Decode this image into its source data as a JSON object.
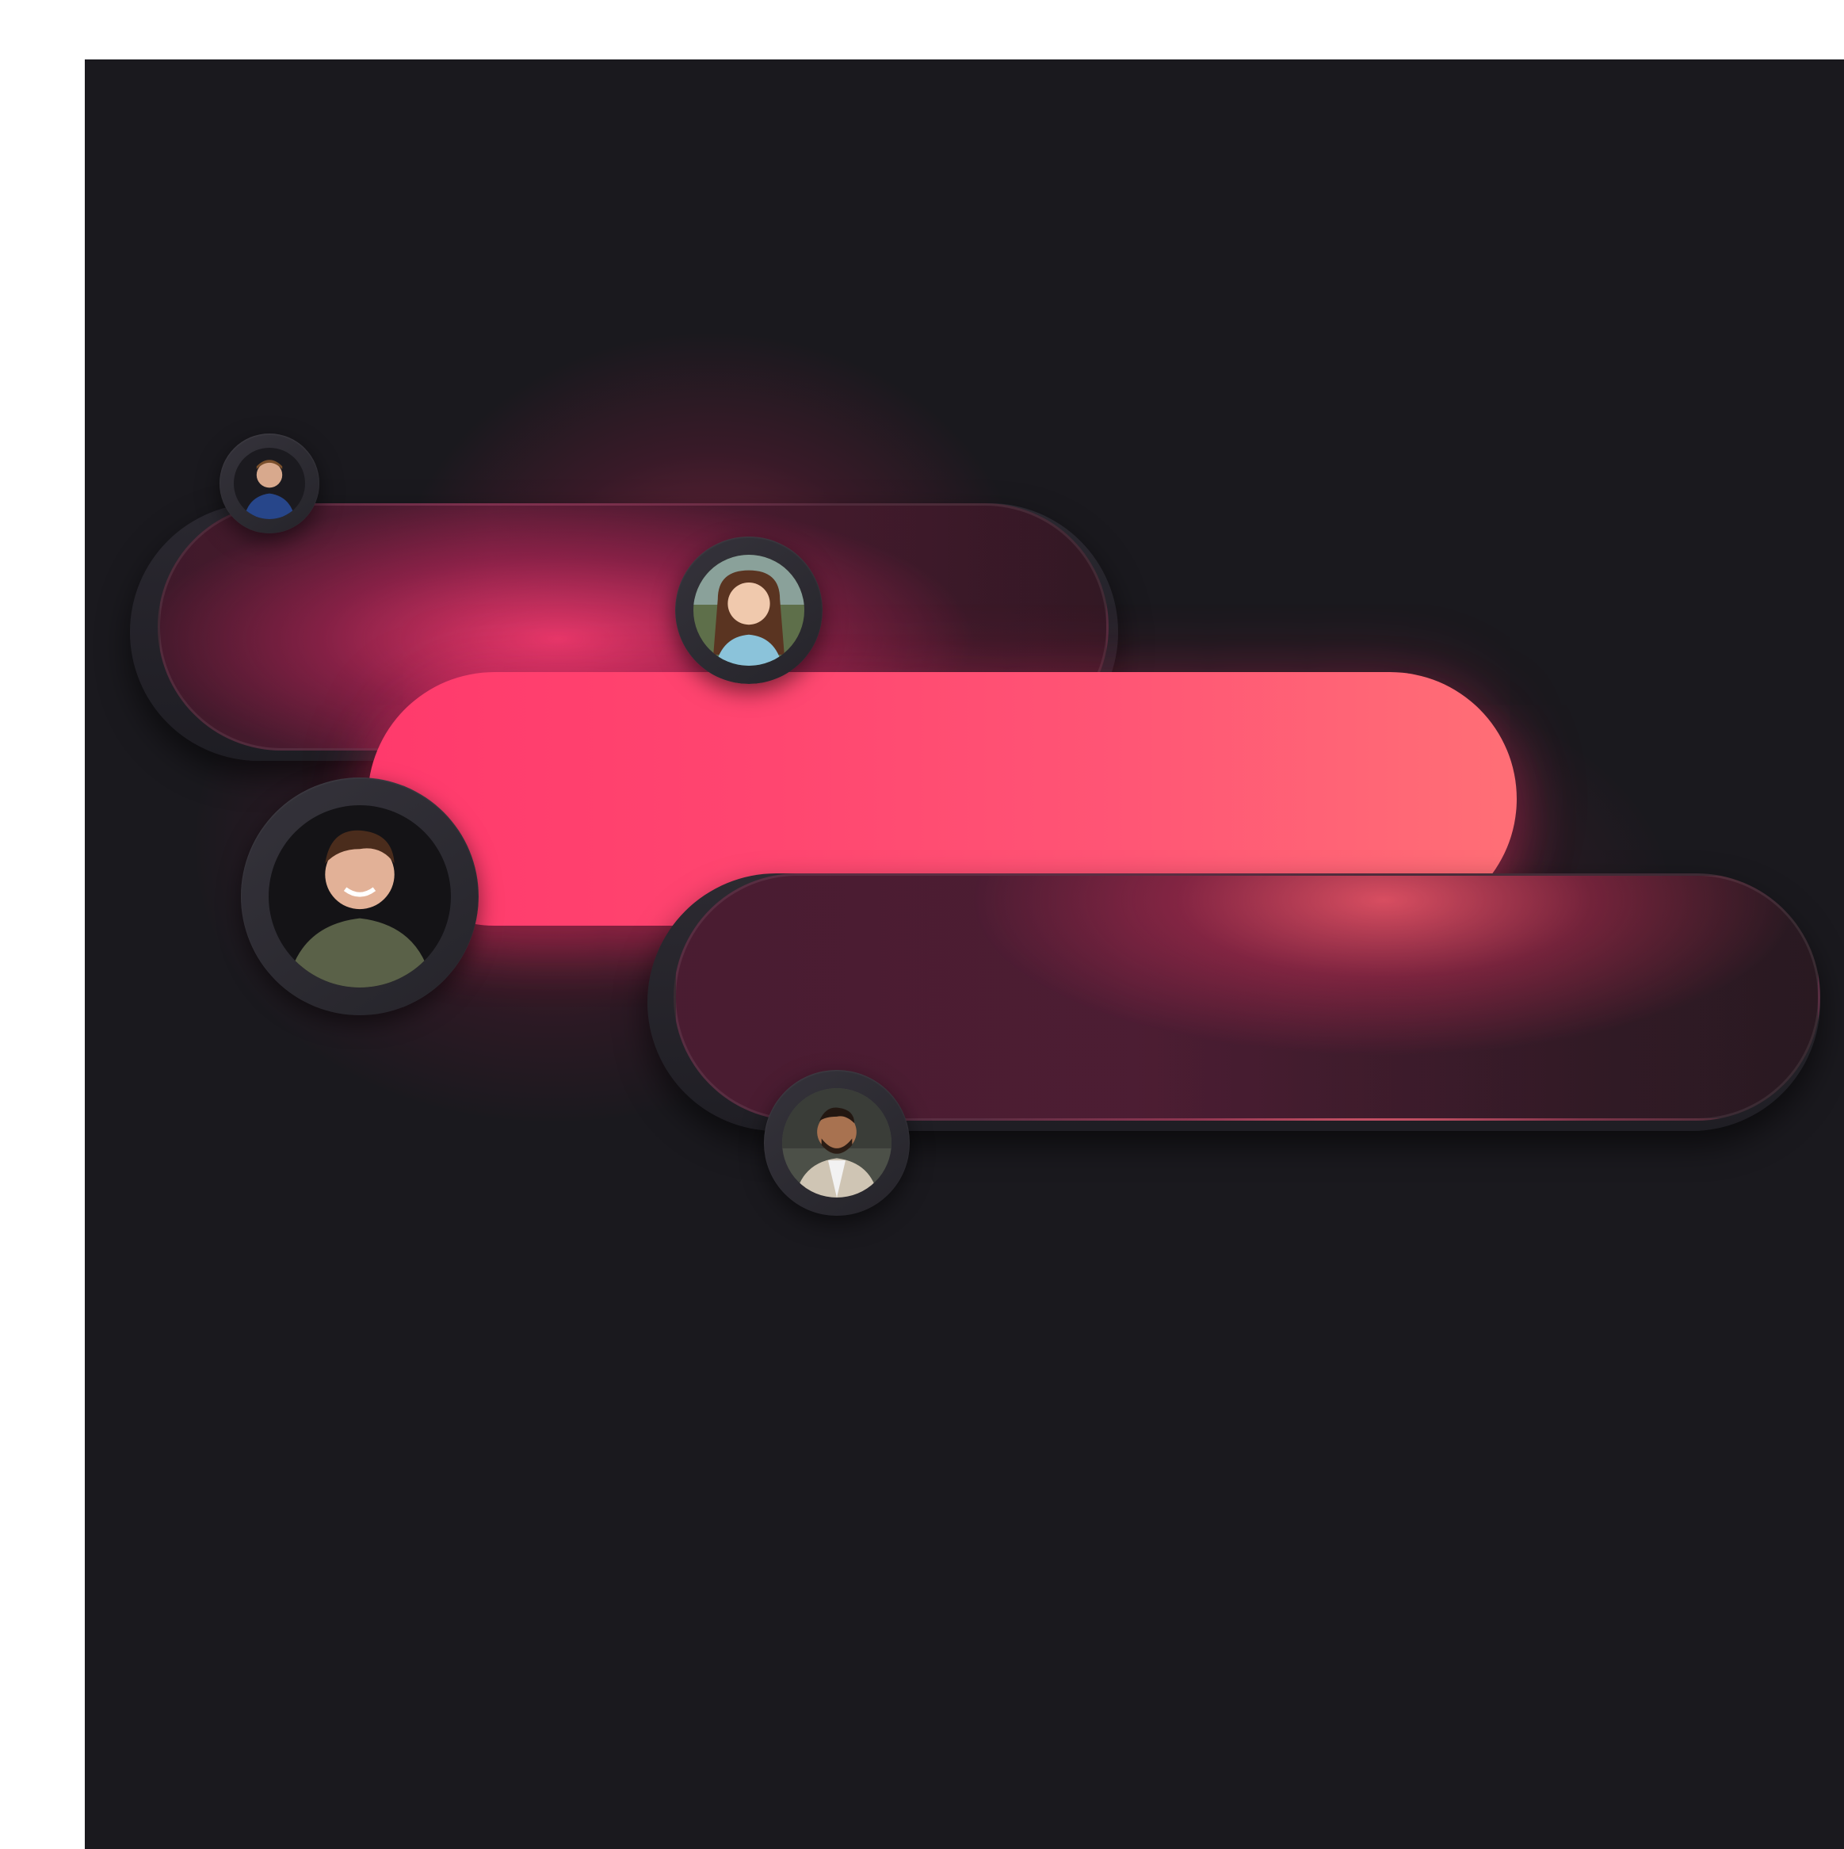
{
  "scene": {
    "background_color": "#1a191e",
    "accent_gradient": [
      "#ff3a6c",
      "#ff6f76"
    ],
    "glow_color": "#ff3c6e"
  },
  "avatars": [
    {
      "name": "user-1",
      "icon": "person-blue-shirt"
    },
    {
      "name": "user-2",
      "icon": "person-long-hair"
    },
    {
      "name": "user-3",
      "icon": "person-green-shirt"
    },
    {
      "name": "user-4",
      "icon": "person-beard-jacket"
    }
  ]
}
